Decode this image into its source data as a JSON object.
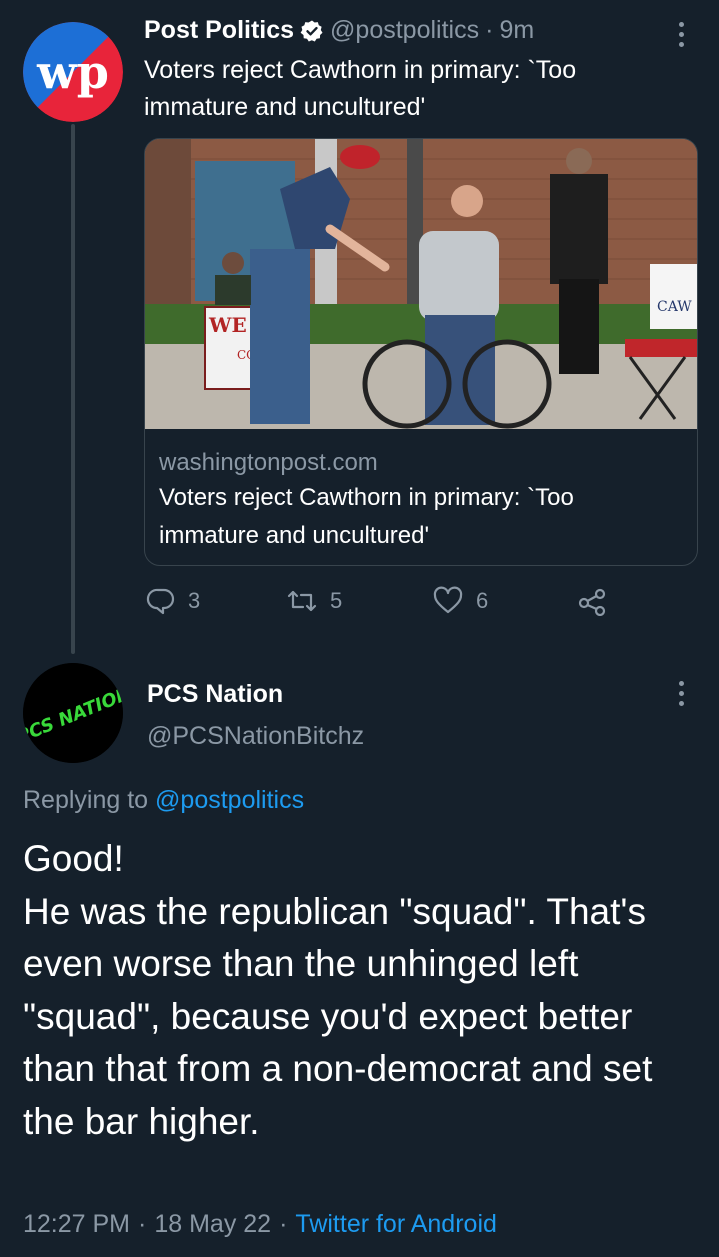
{
  "tweet1": {
    "author_name": "Post Politics",
    "handle": "@postpolitics",
    "time": "9m",
    "separator": "·",
    "text": "Voters reject Cawthorn in primary: `Too immature and uncultured'",
    "card": {
      "domain": "washingtonpost.com",
      "title": "Voters reject Cawthorn in primary: `Too immature and uncultured'"
    },
    "actions": {
      "replies": "3",
      "retweets": "5",
      "likes": "6"
    }
  },
  "tweet2": {
    "author_name": "PCS Nation",
    "handle": "@PCSNationBitchz",
    "avatar_text": "PCS NATION",
    "replying_prefix": "Replying to",
    "replying_handle": "@postpolitics",
    "text": "Good!\nHe was the republican \"squad\". That's even worse than the unhinged left \"squad\", because you'd expect better than that from a non-democrat and set the bar higher.",
    "time": "12:27 PM",
    "date": "18 May 22",
    "source": "Twitter for Android",
    "separator": "·"
  },
  "image_signs": {
    "left_sign": "WE",
    "left_sign_sub": "CONG",
    "right_sign": "CAW"
  },
  "colors": {
    "background": "#15202b",
    "link": "#1d9bf0",
    "muted": "#8b98a5",
    "border": "#38444d",
    "verified": "#ffffff"
  }
}
